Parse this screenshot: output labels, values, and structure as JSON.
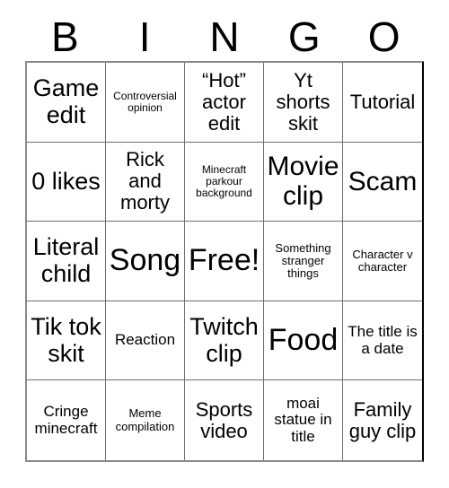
{
  "card": {
    "header_letters": [
      "B",
      "I",
      "N",
      "G",
      "O"
    ],
    "rows": [
      [
        {
          "text": "Game edit",
          "size": "fs-md"
        },
        {
          "text": "Controversial opinion",
          "size": "fs-tiny"
        },
        {
          "text": "“Hot” actor edit",
          "size": "fs-sm"
        },
        {
          "text": "Yt shorts skit",
          "size": "fs-sm"
        },
        {
          "text": "Tutorial",
          "size": "fs-sm"
        }
      ],
      [
        {
          "text": "0 likes",
          "size": "fs-md"
        },
        {
          "text": "Rick and morty",
          "size": "fs-sm"
        },
        {
          "text": "Minecraft parkour background",
          "size": "fs-tiny"
        },
        {
          "text": "Movie clip",
          "size": "fs-lg"
        },
        {
          "text": "Scam",
          "size": "fs-lg"
        }
      ],
      [
        {
          "text": "Literal child",
          "size": "fs-md"
        },
        {
          "text": "Song",
          "size": "fs-xl"
        },
        {
          "text": "Free!",
          "size": "fs-xl"
        },
        {
          "text": "Something stranger things",
          "size": "fs-xxs"
        },
        {
          "text": "Character v character",
          "size": "fs-xxs"
        }
      ],
      [
        {
          "text": "Tik tok skit",
          "size": "fs-md"
        },
        {
          "text": "Reaction",
          "size": "fs-xs"
        },
        {
          "text": "Twitch clip",
          "size": "fs-md"
        },
        {
          "text": "Food",
          "size": "fs-xl"
        },
        {
          "text": "The title is a date",
          "size": "fs-xs"
        }
      ],
      [
        {
          "text": "Cringe minecraft",
          "size": "fs-xs"
        },
        {
          "text": "Meme compilation",
          "size": "fs-xxs"
        },
        {
          "text": "Sports video",
          "size": "fs-sm"
        },
        {
          "text": "moai statue in title",
          "size": "fs-xs"
        },
        {
          "text": "Family guy clip",
          "size": "fs-sm"
        }
      ]
    ],
    "colors": {
      "background": "#ffffff",
      "text": "#000000",
      "grid_line": "#6e6e6e",
      "grid_border": "#000000"
    }
  }
}
